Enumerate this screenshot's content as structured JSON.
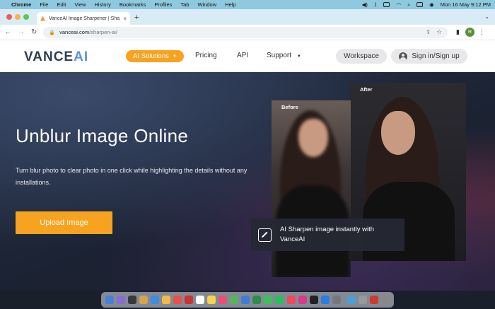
{
  "menubar": {
    "app": "Chrome",
    "items": [
      "File",
      "Edit",
      "View",
      "History",
      "Bookmarks",
      "Profiles",
      "Tab",
      "Window",
      "Help"
    ],
    "clock": "Mon 16 May  9:12 PM"
  },
  "browser": {
    "tab_title": "VanceAI Image Sharpener | Sha",
    "url_host": "vanceai.com",
    "url_path": "/sharpen-ai/",
    "profile_initial": "R"
  },
  "site": {
    "logo_main": "VANCE",
    "logo_ai": "AI",
    "nav": {
      "ai_solutions": "AI Solutions",
      "pricing": "Pricing",
      "api": "API",
      "support": "Support"
    },
    "workspace": "Workspace",
    "signin": "Sign in/Sign up"
  },
  "hero": {
    "title": "Unblur Image Online",
    "description": "Turn blur photo to clear photo in one click while highlighting the details without any installations.",
    "upload_button": "Upload Image",
    "before_label": "Before",
    "after_label": "After",
    "info_text": "AI Sharpen image instantly with VanceAI"
  },
  "dock_icon_colors": [
    "#4a7fd8",
    "#8a6bd1",
    "#3a3a3a",
    "#d6a24a",
    "#3b8ee0",
    "#f2b84b",
    "#e8504a",
    "#cc3333",
    "#ffffff",
    "#f5d34a",
    "#e94e77",
    "#55b35c",
    "#3e7cd6",
    "#2a8d4a",
    "#3fbf5a",
    "#2bbd5a",
    "#f0475b",
    "#d63c8a",
    "#222222",
    "#2a7de1",
    "#777777",
    "#4a9fd8",
    "#999999",
    "#cc3b2b",
    "#888888"
  ]
}
